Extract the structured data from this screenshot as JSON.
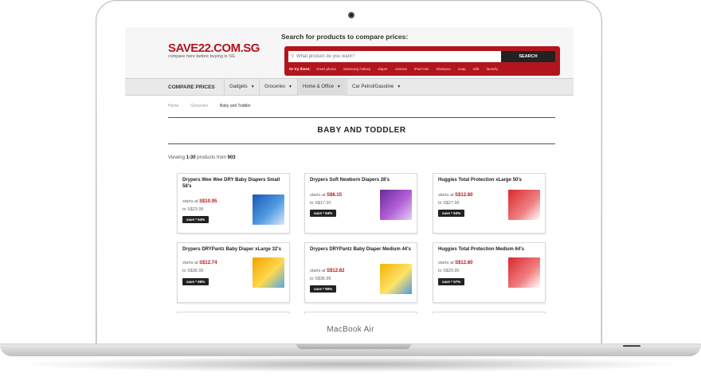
{
  "device": {
    "label": "MacBook Air"
  },
  "site": {
    "logo": "SAVE22.COM.SG",
    "tagline": "compare here before buying in SG",
    "search_title": "Search for products to compare prices:",
    "search_placeholder": "What product do you want?",
    "search_button": "SEARCH",
    "try_label": "Or try these:",
    "try_items": [
      "smart phone",
      "Samsung Galaxy",
      "diaper",
      "camera",
      "iPad mini",
      "shampoo",
      "soap",
      "milk",
      "laundry"
    ]
  },
  "nav": {
    "compare": "COMPARE PRICES",
    "items": [
      "Gadgets",
      "Groceries",
      "Home & Office",
      "Car Petrol/Gasoline"
    ]
  },
  "breadcrumb": [
    "Home",
    "Groceries",
    "Baby and Toddler"
  ],
  "page_title": "BABY AND TODDLER",
  "viewing": {
    "prefix": "Viewing",
    "range": "1-30",
    "middle": "products from",
    "total": "903"
  },
  "starts_label": "starts at",
  "to_label": "to",
  "products": [
    {
      "title": "Drypers Wee Wee DRY Baby Diapers Small 58's",
      "price": "S$10.95",
      "to": "S$23.95",
      "save": "save * 54%",
      "img": "blue"
    },
    {
      "title": "Drypers Soft Newborn Diapers 28's",
      "price": "S$6.15",
      "to": "S$17.20",
      "save": "save * 64%",
      "img": "purple"
    },
    {
      "title": "Huggies Total Protection xLarge 50's",
      "price": "S$12.80",
      "to": "S$27.95",
      "save": "save * 54%",
      "img": "red"
    },
    {
      "title": "Drypers DRYPantz Baby Diaper xLarge 32's",
      "price": "S$12.74",
      "to": "S$36.95",
      "save": "save * 66%",
      "img": "yellow"
    },
    {
      "title": "Drypers DRYPantz Baby Diaper Medium 44's",
      "price": "S$12.82",
      "to": "S$36.95",
      "save": "save * 65%",
      "img": "yellow2"
    },
    {
      "title": "Huggies Total Protection Medium 64's",
      "price": "S$12.80",
      "to": "S$29.95",
      "save": "save * 57%",
      "img": "red"
    }
  ]
}
